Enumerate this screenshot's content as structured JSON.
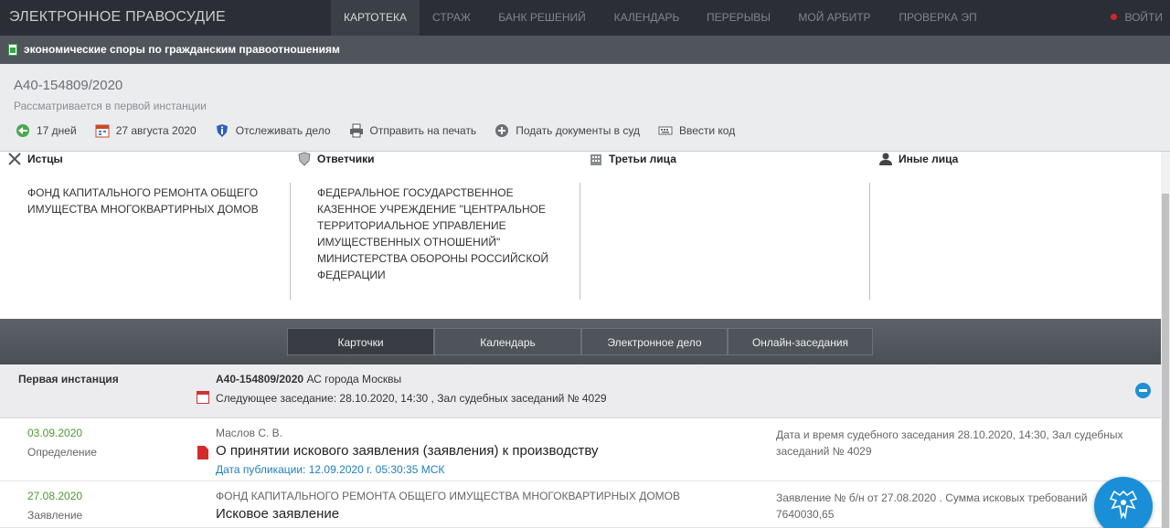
{
  "nav": {
    "brand": "ЭЛЕКТРОННОЕ ПРАВОСУДИЕ",
    "items": [
      {
        "label": "КАРТОТЕКА",
        "active": true
      },
      {
        "label": "СТРАЖ"
      },
      {
        "label": "БАНК РЕШЕНИЙ"
      },
      {
        "label": "КАЛЕНДАРЬ"
      },
      {
        "label": "ПЕРЕРЫВЫ"
      },
      {
        "label": "МОЙ АРБИТР"
      },
      {
        "label": "ПРОВЕРКА ЭП"
      }
    ],
    "login": "ВОЙТИ"
  },
  "category": "экономические споры по гражданским правоотношениям",
  "case": {
    "number": "А40-154809/2020",
    "status": "Рассматривается в первой инстанции",
    "actions": {
      "days": "17 дней",
      "date": "27 августа 2020",
      "track": "Отслеживать дело",
      "print": "Отправить на печать",
      "submit": "Подать документы в суд",
      "code": "Ввести код"
    }
  },
  "parties": {
    "plaintiffs": {
      "title": "Истцы",
      "text": "ФОНД КАПИТАЛЬНОГО РЕМОНТА ОБЩЕГО ИМУЩЕСТВА МНОГОКВАРТИРНЫХ ДОМОВ"
    },
    "defendants": {
      "title": "Ответчики",
      "text": "ФЕДЕРАЛЬНОЕ ГОСУДАРСТВЕННОЕ КАЗЕННОЕ УЧРЕЖДЕНИЕ \"ЦЕНТРАЛЬНОЕ ТЕРРИТОРИАЛЬНОЕ УПРАВЛЕНИЕ ИМУЩЕСТВЕННЫХ ОТНОШЕНИЙ\" МИНИСТЕРСТВА ОБОРОНЫ РОССИЙСКОЙ ФЕДЕРАЦИИ"
    },
    "third": {
      "title": "Третьи лица",
      "text": ""
    },
    "others": {
      "title": "Иные лица",
      "text": ""
    }
  },
  "tabs": [
    "Карточки",
    "Календарь",
    "Электронное дело",
    "Онлайн-заседания"
  ],
  "instance": {
    "label": "Первая инстанция",
    "case_no": "А40-154809/2020",
    "court": "АС города Москвы",
    "next": "Следующее заседание: 28.10.2020, 14:30 , Зал судебных заседаний № 4029"
  },
  "documents": [
    {
      "date": "03.09.2020",
      "type": "Определение",
      "who": "Маслов С. В.",
      "title": "О принятии искового заявления (заявления) к производству",
      "pub": "Дата публикации: 12.09.2020 г. 05:30:35 МСК",
      "note": "Дата и время судебного заседания 28.10.2020, 14:30, Зал судебных заседаний № 4029"
    },
    {
      "date": "27.08.2020",
      "type": "Заявление",
      "who": "ФОНД КАПИТАЛЬНОГО РЕМОНТА ОБЩЕГО ИМУЩЕСТВА МНОГОКВАРТИРНЫХ ДОМОВ",
      "title": "Исковое заявление",
      "note": "Заявление № б/н от 27.08.2020 . Сумма исковых требований 7640030,65"
    }
  ],
  "colors": {
    "nav_bg": "#2b2f35",
    "accent_blue": "#1a8fd8",
    "date_green": "#4b9a2e",
    "link_blue": "#1d7fbe"
  }
}
